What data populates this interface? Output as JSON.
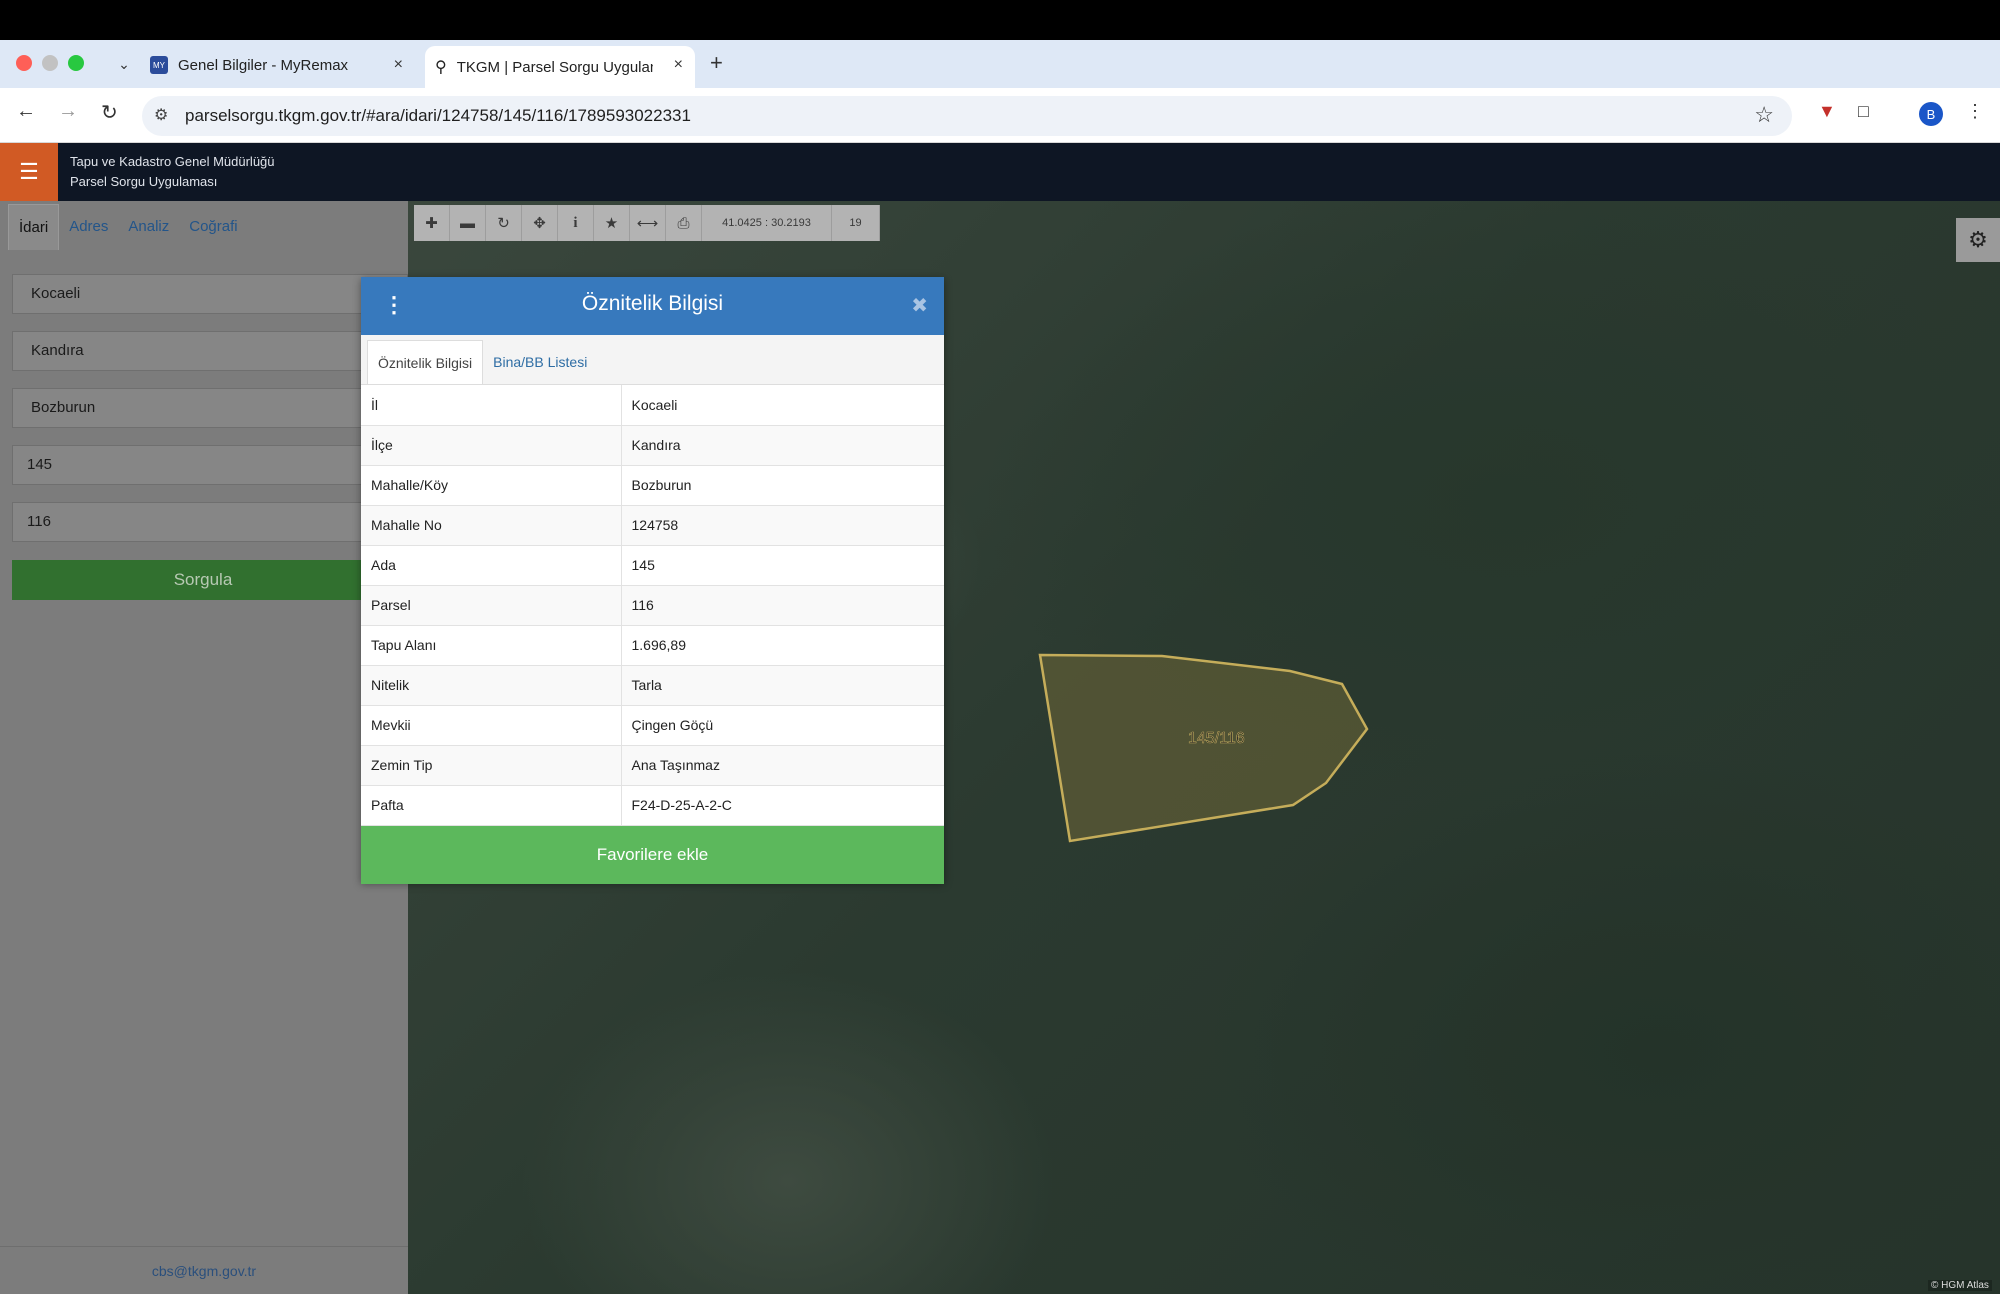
{
  "browser": {
    "tabs": [
      {
        "title": "Genel Bilgiler - MyRemax",
        "favicon": "myremax-icon"
      },
      {
        "title": "TKGM | Parsel Sorgu Uygulaması",
        "favicon": "location-pin-icon"
      }
    ],
    "url": "parselsorgu.tkgm.gov.tr/#ara/idari/124758/145/116/1789593022331",
    "profile_initial": "B"
  },
  "app": {
    "org_line1": "Tapu ve Kadastro Genel Müdürlüğü",
    "org_line2": "Parsel Sorgu Uygulaması",
    "accent_color": "#d15a24"
  },
  "sidebar": {
    "tabs": [
      "İdari",
      "Adres",
      "Analiz",
      "Coğrafi"
    ],
    "fields": [
      "Kocaeli",
      "Kandıra",
      "Bozburun",
      "145",
      "116"
    ],
    "submit_label": "Sorgula",
    "footer_email": "cbs@tkgm.gov.tr"
  },
  "map": {
    "coordinates": "41.0425 : 30.2193",
    "zoom": "19",
    "parcel_label": "145/116",
    "attribution": "© HGM Atlas"
  },
  "modal": {
    "title": "Öznitelik Bilgisi",
    "tabs": [
      "Öznitelik Bilgisi",
      "Bina/BB Listesi"
    ],
    "rows": [
      {
        "k": "İl",
        "v": "Kocaeli"
      },
      {
        "k": "İlçe",
        "v": "Kandıra"
      },
      {
        "k": "Mahalle/Köy",
        "v": "Bozburun"
      },
      {
        "k": "Mahalle No",
        "v": "124758"
      },
      {
        "k": "Ada",
        "v": "145"
      },
      {
        "k": "Parsel",
        "v": "116"
      },
      {
        "k": "Tapu Alanı",
        "v": "1.696,89"
      },
      {
        "k": "Nitelik",
        "v": "Tarla"
      },
      {
        "k": "Mevkii",
        "v": "Çingen Göçü"
      },
      {
        "k": "Zemin Tip",
        "v": "Ana Taşınmaz"
      },
      {
        "k": "Pafta",
        "v": "F24-D-25-A-2-C"
      }
    ],
    "favorite_label": "Favorilere ekle"
  }
}
